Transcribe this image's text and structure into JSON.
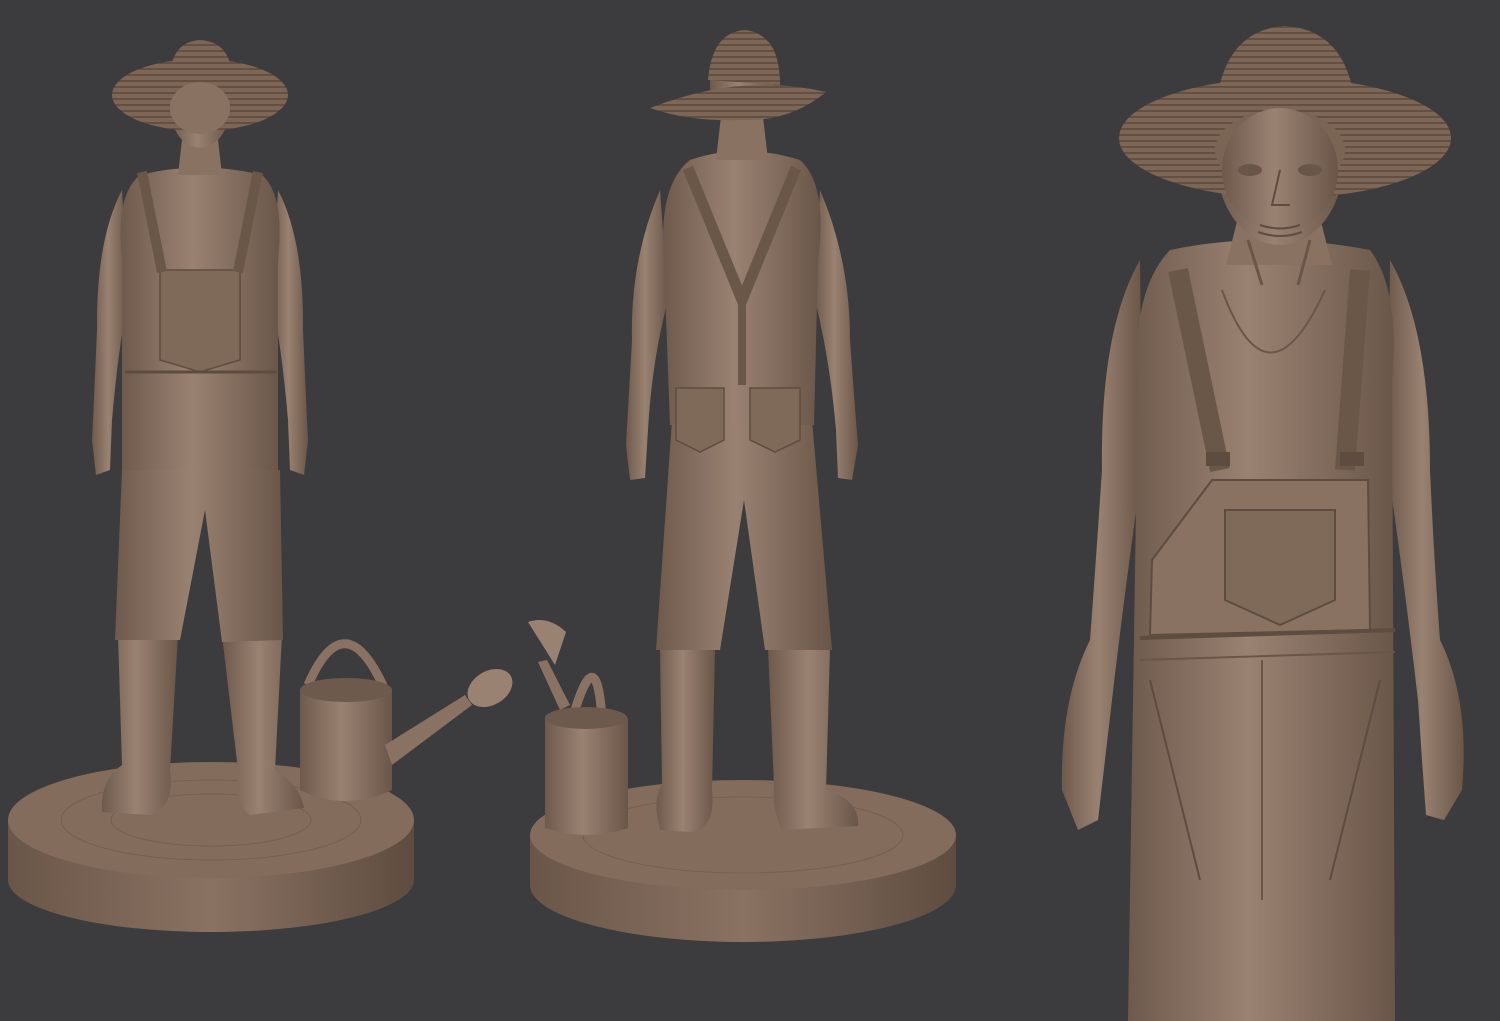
{
  "scene": {
    "background": "#3c3c3e",
    "material": "#8c7565",
    "material_light": "#a08878",
    "material_dark": "#5e4c40",
    "views": [
      "front-view",
      "back-view",
      "closeup-view"
    ]
  }
}
